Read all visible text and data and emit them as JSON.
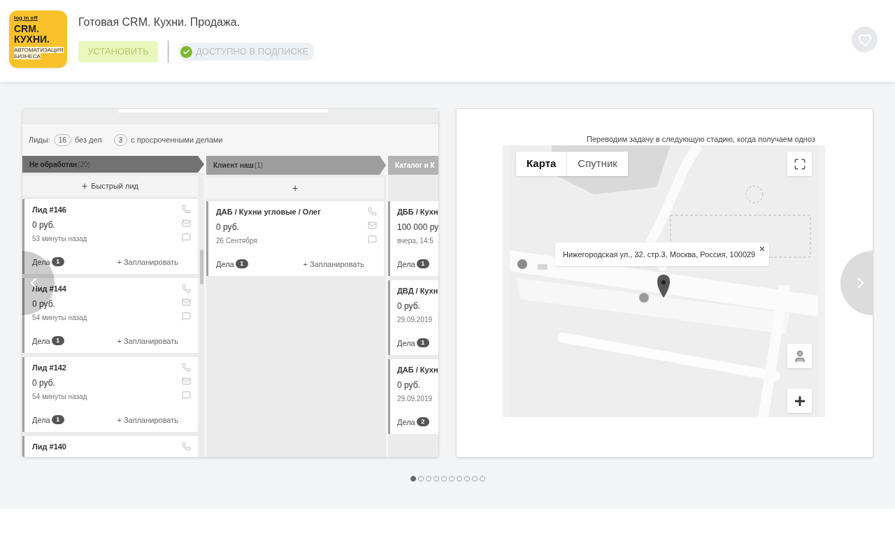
{
  "header": {
    "logo": {
      "lines": [
        {
          "kind": "tag",
          "text": "log in off"
        },
        {
          "kind": "main",
          "text": "CRM."
        },
        {
          "kind": "main",
          "text": "КУХНИ."
        },
        {
          "kind": "strip",
          "text": "АВТОМАТИЗАЦИЯ"
        },
        {
          "kind": "strip",
          "text": "БИЗНЕСА"
        }
      ]
    },
    "title": "Готовая CRM. Кухни. Продажа.",
    "install_button": {
      "label": "УСТАНОВИТЬ",
      "disabled": true
    },
    "subscription_badge": "ДОСТУПНО В ПОДПИСКЕ",
    "favorite": false
  },
  "gallery": {
    "slides": [
      {
        "kind": "crm",
        "summary": {
          "label": "Лиды:",
          "count_1": "16",
          "text_1": "без дел",
          "count_2": "3",
          "text_2": "с просроченными делами"
        },
        "columns": [
          {
            "title": "Не обработан",
            "count": "(20)",
            "color": "#737373",
            "add_button": {
              "icon": "+",
              "label": "Быстрый лид"
            },
            "cards": [
              {
                "title": "Лид #146",
                "amount": "0 руб.",
                "time": "53 минуты назад",
                "tasks_label": "Дела",
                "tasks_count": "1",
                "schedule": "+ Запланировать"
              },
              {
                "title": "Лид #144",
                "amount": "0 руб.",
                "time": "54 минуты назад",
                "tasks_label": "Дела",
                "tasks_count": "1",
                "schedule": "+ Запланировать"
              },
              {
                "title": "Лид #142",
                "amount": "0 руб.",
                "time": "54 минуты назад",
                "tasks_label": "Дела",
                "tasks_count": "1",
                "schedule": "+ Запланировать"
              },
              {
                "title": "Лид #140"
              }
            ]
          },
          {
            "title": "Клиент наш",
            "count": "(1)",
            "color": "#9e9e9e",
            "add_button": {
              "icon": "+"
            },
            "cards": [
              {
                "title": "ДАБ / Кухни угловые / Олег",
                "amount": "0 руб.",
                "time": "26 Сентября",
                "tasks_label": "Дела",
                "tasks_count": "1",
                "schedule": "+ Запланировать"
              }
            ]
          },
          {
            "title": "Каталог и К",
            "color": "#b3b3b3",
            "cards": [
              {
                "title": "ДББ / Кухн",
                "amount": "100 000 ру",
                "time": "вчера, 14:5",
                "tasks_label": "Дела",
                "tasks_count": "1"
              },
              {
                "title": "ДВД / Кухн",
                "amount": "0 руб.",
                "time": "29.09.2019",
                "tasks_label": "Дела",
                "tasks_count": "1"
              },
              {
                "title": "ДАБ / Кухн",
                "amount": "0 руб.",
                "time": "29.09.2019",
                "tasks_label": "Дела",
                "tasks_count": "2"
              }
            ]
          }
        ]
      },
      {
        "kind": "map",
        "caption": "Переводим задачу в следующую стадию, когда получаем одноз",
        "map_types": [
          {
            "label": "Карта",
            "selected": true
          },
          {
            "label": "Спутник",
            "selected": false
          }
        ],
        "info_window": "Нижегородская ул., 32. стр.3, Москва, Россия, 100029"
      }
    ],
    "dots": [
      {
        "selected": true
      },
      {
        "selected": false
      },
      {
        "selected": false
      },
      {
        "selected": false
      },
      {
        "selected": false
      },
      {
        "selected": false
      },
      {
        "selected": false
      },
      {
        "selected": false
      },
      {
        "selected": false
      },
      {
        "selected": false
      }
    ]
  }
}
